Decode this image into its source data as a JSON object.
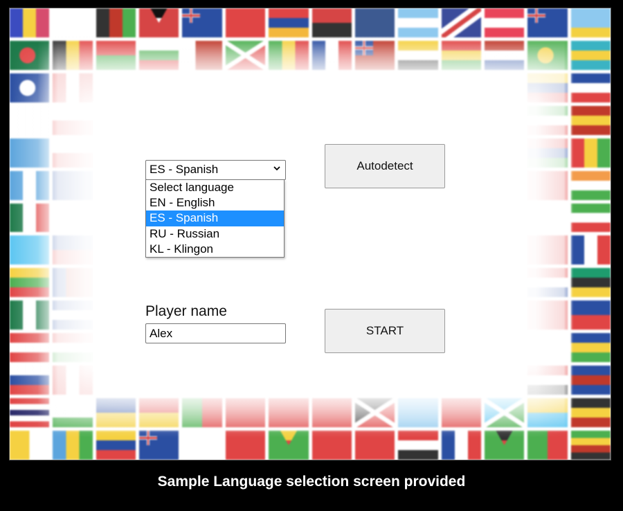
{
  "caption": "Sample Language selection screen provided",
  "language_select": {
    "selected_value": "ES - Spanish",
    "options": [
      {
        "label": "Select language",
        "selected": false
      },
      {
        "label": "EN - English",
        "selected": false
      },
      {
        "label": "ES - Spanish",
        "selected": true
      },
      {
        "label": "RU - Russian",
        "selected": false
      },
      {
        "label": "KL - Klingon",
        "selected": false
      }
    ],
    "highlight_color": "#1e90ff"
  },
  "current_language_label": "ES",
  "autodetect_button": {
    "label": "Autodetect"
  },
  "player_name": {
    "label": "Player name",
    "value": "Alex"
  },
  "start_button": {
    "label": "START"
  },
  "background_flags": {
    "description": "decorative faded grid of world flags",
    "rows": [
      [
        [
          "v",
          "#3b4cc0",
          "#f5d142",
          "#d64c6e"
        ],
        [
          "ae",
          "#e34b4b",
          "#4caf50",
          "#ffffff",
          "#333333"
        ],
        [
          "v",
          "#333333",
          "#c0392b",
          "#4caf50"
        ],
        [
          "ag",
          "#d64545",
          "#ffffff",
          "#2b4fa2",
          "#111111"
        ],
        [
          "uk",
          "#2b4fa2"
        ],
        [
          "s",
          "#e04545"
        ],
        [
          "h",
          "#e04545",
          "#2b4fa2",
          "#f3b73c"
        ],
        [
          "h",
          "#d64545",
          "#333333"
        ],
        [
          "s",
          "#3d5a91"
        ],
        [
          "h",
          "#8ec9ef",
          "#ffffff",
          "#8ec9ef"
        ],
        [
          "as",
          "#3b4c9b",
          "#ffffff",
          "#d64545"
        ],
        [
          "h",
          "#e9445a",
          "#ffffff",
          "#e9445a"
        ],
        [
          "uk",
          "#2b4fa2"
        ],
        [
          "h",
          "#8ec9ef",
          "#8ec9ef",
          "#f3d142"
        ]
      ],
      [
        [
          "circle",
          "#1e7a4a",
          "#e34b4b"
        ],
        [
          "v",
          "#333333",
          "#f5d142",
          "#e34b4b"
        ],
        [
          "h",
          "#e04545",
          "#4caf50"
        ],
        [
          "h",
          "#ffffff",
          "#4caf50",
          "#e04545"
        ],
        [
          "v",
          "#ffffff",
          "#c0392b",
          "#c0392b"
        ],
        [
          "x",
          "#e04545",
          "#4caf50"
        ],
        [
          "v",
          "#4caf50",
          "#f5d142",
          "#e04545"
        ],
        [
          "v",
          "#2b4fa2",
          "#ffffff",
          "#e04545"
        ],
        [
          "uk",
          "#c0392b"
        ],
        [
          "h",
          "#f5d142",
          "#ffffff",
          "#333333"
        ],
        [
          "h",
          "#e04545",
          "#f5d142",
          "#4caf50"
        ],
        [
          "h",
          "#c0392b",
          "#ffffff",
          "#2b4fa2"
        ],
        [
          "circle",
          "#4caf50",
          "#f5d142"
        ],
        [
          "h",
          "#3bb3c3",
          "#f5d142",
          "#3bb3c3"
        ]
      ],
      [
        [
          "circle",
          "#2b4fa2",
          "#ffffff"
        ],
        [
          "v",
          "#e04545",
          "#ffffff",
          "#e04545"
        ],
        [
          "s",
          "#ffffff"
        ],
        [
          "s",
          "#ffffff"
        ],
        [
          "s",
          "#ffffff"
        ],
        [
          "s",
          "#ffffff"
        ],
        [
          "s",
          "#ffffff"
        ],
        [
          "s",
          "#ffffff"
        ],
        [
          "s",
          "#ffffff"
        ],
        [
          "s",
          "#ffffff"
        ],
        [
          "s",
          "#ffffff"
        ],
        [
          "s",
          "#ffffff"
        ],
        [
          "h",
          "#f5d142",
          "#2b4fa2",
          "#e04545"
        ],
        [
          "h",
          "#2b4fa2",
          "#ffffff",
          "#e04545"
        ]
      ],
      [
        [
          "s",
          "#ffffff"
        ],
        [
          "h",
          "#ffffff",
          "#e04545"
        ],
        [
          "s",
          "#ffffff"
        ],
        [
          "s",
          "#ffffff"
        ],
        [
          "s",
          "#ffffff"
        ],
        [
          "s",
          "#ffffff"
        ],
        [
          "s",
          "#ffffff"
        ],
        [
          "s",
          "#ffffff"
        ],
        [
          "s",
          "#ffffff"
        ],
        [
          "s",
          "#ffffff"
        ],
        [
          "s",
          "#ffffff"
        ],
        [
          "s",
          "#ffffff"
        ],
        [
          "h",
          "#4caf50",
          "#ffffff",
          "#e04545"
        ],
        [
          "h",
          "#c0392b",
          "#f5d142",
          "#c0392b"
        ]
      ],
      [
        [
          "s",
          "#5ca5dd"
        ],
        [
          "h",
          "#ffffff",
          "#e04545"
        ],
        [
          "s",
          "#ffffff"
        ],
        [
          "s",
          "#ffffff"
        ],
        [
          "s",
          "#ffffff"
        ],
        [
          "s",
          "#ffffff"
        ],
        [
          "s",
          "#ffffff"
        ],
        [
          "s",
          "#ffffff"
        ],
        [
          "s",
          "#ffffff"
        ],
        [
          "s",
          "#ffffff"
        ],
        [
          "s",
          "#ffffff"
        ],
        [
          "s",
          "#ffffff"
        ],
        [
          "h",
          "#e04545",
          "#2b4fa2",
          "#4caf50"
        ],
        [
          "v",
          "#e04545",
          "#f5d142",
          "#4caf50"
        ]
      ],
      [
        [
          "v",
          "#5ca5dd",
          "#ffffff",
          "#5ca5dd"
        ],
        [
          "s",
          "#2b4fa2"
        ],
        [
          "s",
          "#ffffff"
        ],
        [
          "s",
          "#ffffff"
        ],
        [
          "s",
          "#ffffff"
        ],
        [
          "s",
          "#ffffff"
        ],
        [
          "s",
          "#ffffff"
        ],
        [
          "s",
          "#ffffff"
        ],
        [
          "s",
          "#ffffff"
        ],
        [
          "s",
          "#ffffff"
        ],
        [
          "s",
          "#ffffff"
        ],
        [
          "s",
          "#ffffff"
        ],
        [
          "s",
          "#e04545"
        ],
        [
          "h",
          "#f39c4b",
          "#ffffff",
          "#4caf50"
        ]
      ],
      [
        [
          "v",
          "#1e7a4a",
          "#ffffff",
          "#e04545"
        ],
        [
          "s",
          "#ffffff"
        ],
        [
          "s",
          "#ffffff"
        ],
        [
          "s",
          "#ffffff"
        ],
        [
          "s",
          "#ffffff"
        ],
        [
          "s",
          "#ffffff"
        ],
        [
          "s",
          "#ffffff"
        ],
        [
          "s",
          "#ffffff"
        ],
        [
          "s",
          "#ffffff"
        ],
        [
          "s",
          "#ffffff"
        ],
        [
          "s",
          "#ffffff"
        ],
        [
          "s",
          "#ffffff"
        ],
        [
          "s",
          "#ffffff"
        ],
        [
          "h",
          "#4caf50",
          "#ffffff",
          "#e04545"
        ]
      ],
      [
        [
          "s",
          "#5cc6f2"
        ],
        [
          "h",
          "#2b4fa2",
          "#e04545"
        ],
        [
          "s",
          "#ffffff"
        ],
        [
          "s",
          "#ffffff"
        ],
        [
          "s",
          "#ffffff"
        ],
        [
          "s",
          "#ffffff"
        ],
        [
          "s",
          "#ffffff"
        ],
        [
          "s",
          "#ffffff"
        ],
        [
          "s",
          "#ffffff"
        ],
        [
          "s",
          "#ffffff"
        ],
        [
          "s",
          "#ffffff"
        ],
        [
          "s",
          "#ffffff"
        ],
        [
          "s",
          "#e04545"
        ],
        [
          "v",
          "#2b4fa2",
          "#ffffff",
          "#e04545"
        ]
      ],
      [
        [
          "h",
          "#f5d142",
          "#4caf50",
          "#e04545"
        ],
        [
          "v",
          "#2b4fa2",
          "#c0392b",
          "#c0392b"
        ],
        [
          "s",
          "#ffffff"
        ],
        [
          "s",
          "#ffffff"
        ],
        [
          "s",
          "#ffffff"
        ],
        [
          "s",
          "#ffffff"
        ],
        [
          "s",
          "#ffffff"
        ],
        [
          "s",
          "#ffffff"
        ],
        [
          "s",
          "#ffffff"
        ],
        [
          "s",
          "#ffffff"
        ],
        [
          "s",
          "#ffffff"
        ],
        [
          "s",
          "#ffffff"
        ],
        [
          "h",
          "#e04545",
          "#ffffff",
          "#2b4fa2"
        ],
        [
          "h",
          "#1e9c6e",
          "#333333",
          "#f5d142"
        ]
      ],
      [
        [
          "v",
          "#1e7a4a",
          "#ffffff",
          "#1e7a4a"
        ],
        [
          "h",
          "#2b4fa2",
          "#ffffff",
          "#2b4fa2"
        ],
        [
          "s",
          "#ffffff"
        ],
        [
          "s",
          "#ffffff"
        ],
        [
          "s",
          "#ffffff"
        ],
        [
          "s",
          "#ffffff"
        ],
        [
          "s",
          "#ffffff"
        ],
        [
          "s",
          "#ffffff"
        ],
        [
          "s",
          "#ffffff"
        ],
        [
          "s",
          "#ffffff"
        ],
        [
          "s",
          "#ffffff"
        ],
        [
          "s",
          "#ffffff"
        ],
        [
          "s",
          "#e04545"
        ],
        [
          "h",
          "#2b4fa2",
          "#e04545"
        ]
      ],
      [
        [
          "h",
          "#e04545",
          "#ffffff",
          "#e04545"
        ],
        [
          "h",
          "#e04545",
          "#ffffff",
          "#4caf50"
        ],
        [
          "s",
          "#ffffff"
        ],
        [
          "s",
          "#ffffff"
        ],
        [
          "s",
          "#ffffff"
        ],
        [
          "s",
          "#ffffff"
        ],
        [
          "s",
          "#ffffff"
        ],
        [
          "s",
          "#ffffff"
        ],
        [
          "s",
          "#ffffff"
        ],
        [
          "s",
          "#ffffff"
        ],
        [
          "s",
          "#ffffff"
        ],
        [
          "s",
          "#ffffff"
        ],
        [
          "s",
          "#ffffff"
        ],
        [
          "h",
          "#2b4fa2",
          "#f5d142",
          "#4caf50"
        ]
      ],
      [
        [
          "h",
          "#ffffff",
          "#2b4fa2",
          "#e04545"
        ],
        [
          "v",
          "#e04545",
          "#ffffff",
          "#e04545"
        ],
        [
          "s",
          "#ffffff"
        ],
        [
          "s",
          "#ffffff"
        ],
        [
          "s",
          "#ffffff"
        ],
        [
          "s",
          "#ffffff"
        ],
        [
          "s",
          "#ffffff"
        ],
        [
          "s",
          "#ffffff"
        ],
        [
          "s",
          "#ffffff"
        ],
        [
          "s",
          "#ffffff"
        ],
        [
          "s",
          "#ffffff"
        ],
        [
          "s",
          "#ffffff"
        ],
        [
          "h",
          "#e04545",
          "#ffffff",
          "#333333"
        ],
        [
          "h",
          "#2b4fa2",
          "#c0392b",
          "#2b4fa2"
        ]
      ],
      [
        [
          "h",
          "#e04545",
          "#ffffff",
          "#2b2b6b",
          "#ffffff",
          "#e04545"
        ],
        [
          "h",
          "#ffffff",
          "#ffffff",
          "#4caf50"
        ],
        [
          "h",
          "#2b4fa2",
          "#f5d142"
        ],
        [
          "h",
          "#e04545",
          "#f5d142"
        ],
        [
          "v",
          "#4caf50",
          "#e04545"
        ],
        [
          "s",
          "#e04545"
        ],
        [
          "s",
          "#e04545"
        ],
        [
          "s",
          "#e04545"
        ],
        [
          "x",
          "#e04545",
          "#333333"
        ],
        [
          "s",
          "#8ec9ef"
        ],
        [
          "s",
          "#e04545"
        ],
        [
          "x",
          "#4caf50",
          "#5cc6f2"
        ],
        [
          "h",
          "#f5d142",
          "#5cc6f2"
        ],
        [
          "h",
          "#333333",
          "#f5d142",
          "#c0392b"
        ]
      ],
      [
        [
          "v",
          "#f5d142",
          "#ffffff"
        ],
        [
          "v",
          "#5ca5dd",
          "#f5d142",
          "#4caf50"
        ],
        [
          "h",
          "#f5d142",
          "#2b4fa2",
          "#e04545"
        ],
        [
          "uk",
          "#2b4fa2"
        ],
        [
          "s",
          "#ffffff"
        ],
        [
          "s",
          "#e04545"
        ],
        [
          "ag",
          "#4caf50",
          "#e04545",
          "#333333",
          "#f5d142"
        ],
        [
          "s",
          "#e04545"
        ],
        [
          "s",
          "#e04545"
        ],
        [
          "h",
          "#e04545",
          "#ffffff",
          "#333333"
        ],
        [
          "v",
          "#2b4fa2",
          "#ffffff",
          "#e04545"
        ],
        [
          "ag",
          "#4caf50",
          "#e04545",
          "#2b4fa2",
          "#333333"
        ],
        [
          "v",
          "#4caf50",
          "#e04545"
        ],
        [
          "h",
          "#4caf50",
          "#f5d142",
          "#c0392b",
          "#333333"
        ]
      ]
    ]
  }
}
